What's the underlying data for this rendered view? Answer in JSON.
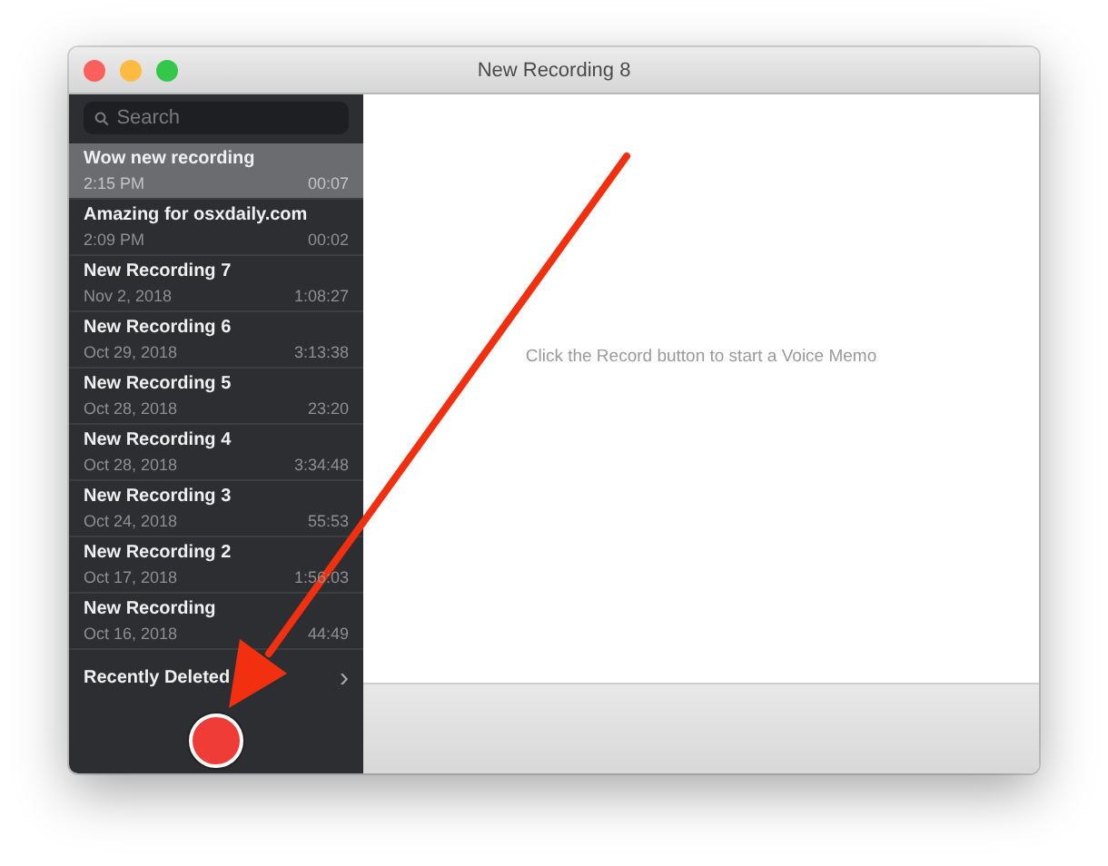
{
  "window": {
    "title": "New Recording 8"
  },
  "search": {
    "placeholder": "Search"
  },
  "recordings": [
    {
      "title": "Wow new recording",
      "date": "2:15 PM",
      "duration": "00:07",
      "selected": true
    },
    {
      "title": "Amazing for osxdaily.com",
      "date": "2:09 PM",
      "duration": "00:02",
      "selected": false
    },
    {
      "title": "New Recording 7",
      "date": "Nov 2, 2018",
      "duration": "1:08:27",
      "selected": false
    },
    {
      "title": "New Recording 6",
      "date": "Oct 29, 2018",
      "duration": "3:13:38",
      "selected": false
    },
    {
      "title": "New Recording 5",
      "date": "Oct 28, 2018",
      "duration": "23:20",
      "selected": false
    },
    {
      "title": "New Recording 4",
      "date": "Oct 28, 2018",
      "duration": "3:34:48",
      "selected": false
    },
    {
      "title": "New Recording 3",
      "date": "Oct 24, 2018",
      "duration": "55:53",
      "selected": false
    },
    {
      "title": "New Recording 2",
      "date": "Oct 17, 2018",
      "duration": "1:56:03",
      "selected": false
    },
    {
      "title": "New Recording",
      "date": "Oct 16, 2018",
      "duration": "44:49",
      "selected": false
    }
  ],
  "recently_deleted": {
    "label": "Recently Deleted",
    "chevron": "›"
  },
  "main": {
    "hint": "Click the Record button to start a Voice Memo"
  }
}
